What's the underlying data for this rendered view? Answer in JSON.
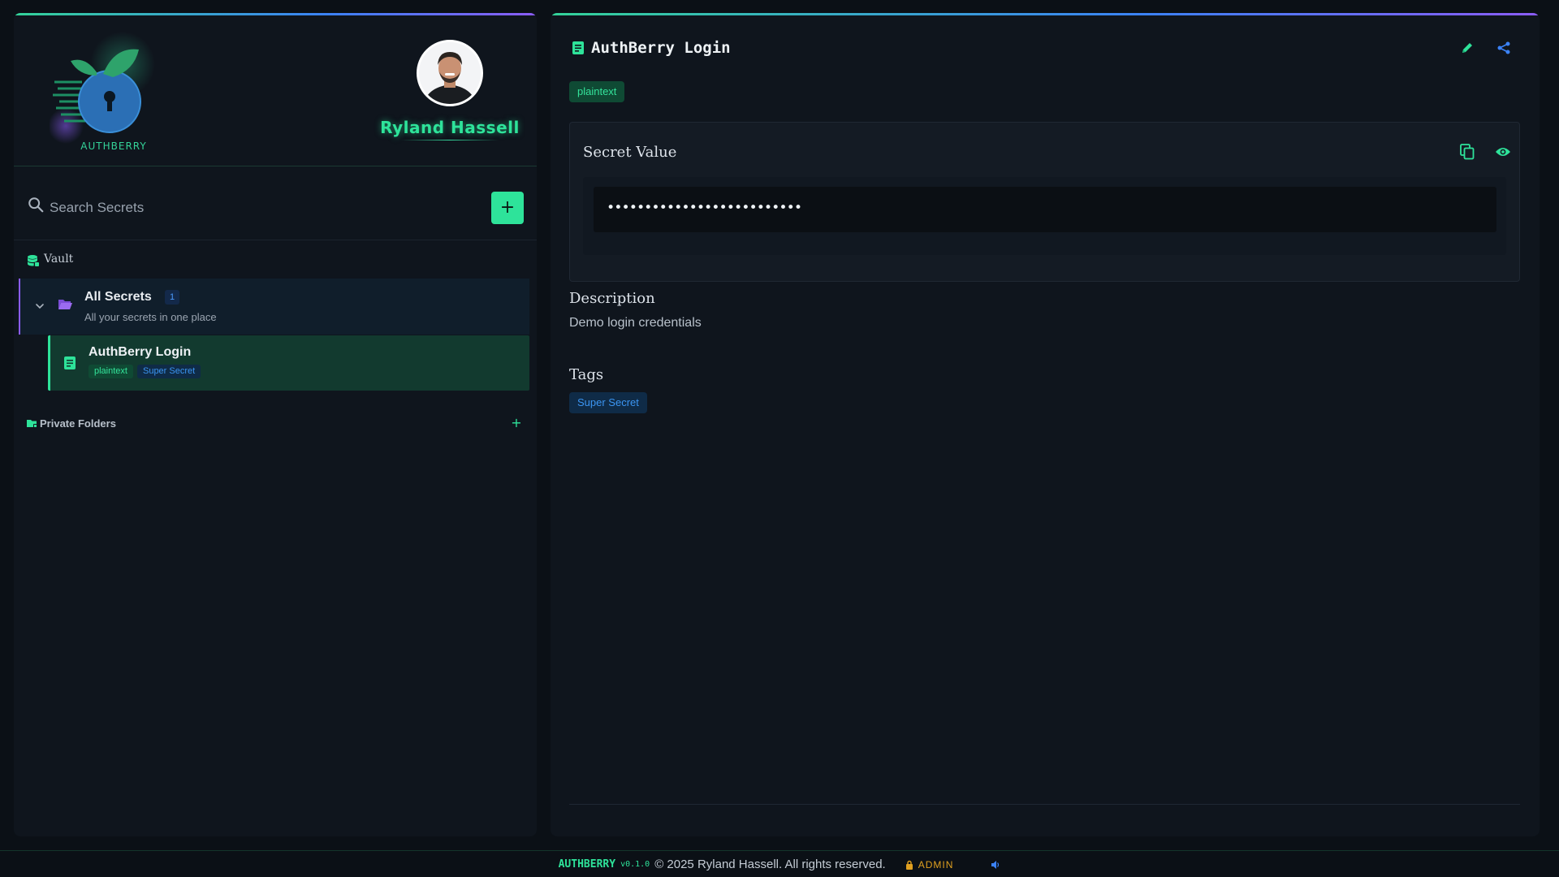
{
  "app": {
    "logo_text": "AUTHBERRY",
    "accent_color": "#2ee39a"
  },
  "profile": {
    "user_name": "Ryland Hassell"
  },
  "sidebar": {
    "search_placeholder": "Search Secrets",
    "add_button_label": "+",
    "vault_label": "Vault",
    "folders": [
      {
        "title": "All Secrets",
        "count": "1",
        "subtitle": "All your secrets in one place",
        "expanded": true,
        "items": [
          {
            "title": "AuthBerry Login",
            "type_badge": "plaintext",
            "tag_badge": "Super Secret",
            "selected": true
          }
        ]
      }
    ],
    "private_folders_label": "Private Folders",
    "private_add_label": "+"
  },
  "detail": {
    "title": "AuthBerry Login",
    "type_badge": "plaintext",
    "secret_card_title": "Secret Value",
    "masked_value": "••••••••••••••••••••••••••",
    "description_heading": "Description",
    "description_text": "Demo login credentials",
    "tags_heading": "Tags",
    "tags": [
      "Super Secret"
    ]
  },
  "footer": {
    "brand": "AUTHBERRY",
    "version": "v0.1.0",
    "copyright": "© 2025 Ryland Hassell. All rights reserved.",
    "role": "ADMIN"
  },
  "icons": {
    "search": "search-icon",
    "add": "plus-icon",
    "vault": "database-icon",
    "chevron": "chevron-down-icon",
    "folder": "folder-open-icon",
    "document": "document-icon",
    "private_folder": "folder-lock-icon",
    "edit": "pencil-icon",
    "share": "share-icon",
    "copy": "copy-icon",
    "reveal": "eye-icon",
    "role": "lock-icon",
    "sound": "speaker-icon"
  }
}
